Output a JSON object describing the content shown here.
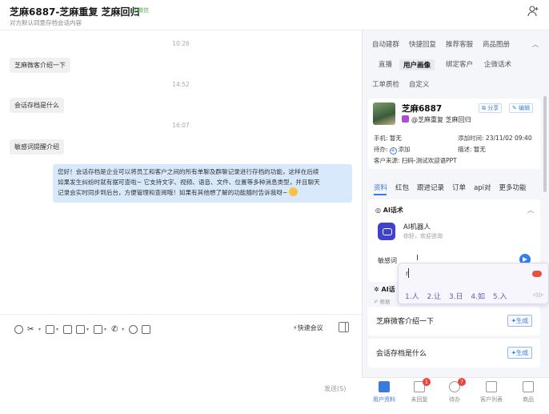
{
  "header": {
    "title": "芝麻6887-芝麻重复 芝麻回归",
    "tag": "@微信",
    "subtitle": "对方默认同意存档会话内容"
  },
  "chat": {
    "messages": [
      {
        "type": "time",
        "text": "10:26"
      },
      {
        "type": "left",
        "text": "芝麻微客介绍一下"
      },
      {
        "type": "time",
        "text": "14:52"
      },
      {
        "type": "left",
        "text": "会话存档是什么"
      },
      {
        "type": "time",
        "text": "16:07"
      },
      {
        "type": "left",
        "text": "敏感词提醒介绍"
      },
      {
        "type": "right",
        "line1": "您好！会话存档是企业可以将员工和客户之间的所有单聊及群聊记录进行存档的功能，这样在后续",
        "line2": "如果发生纠纷时就有据可查啦~ 它支持文字、视频、语音、文件、位置等多种消息类型，并且聊天",
        "line3": "记录会实时同步到后台，方便管理和查阅哦！如果有其他想了解的功能随时告诉我呀~"
      }
    ]
  },
  "composer": {
    "quick_meeting": "快速会议",
    "send_label": "发送(S)"
  },
  "right_panel": {
    "tabs_row1": [
      "自动建群",
      "快捷回复",
      "推荐客服",
      "商品图册"
    ],
    "tabs_row2": [
      "直播",
      "用户画像",
      "绑定客户",
      "企微话术"
    ],
    "tabs_row3": [
      "工单质检",
      "自定义"
    ],
    "active_tab": "用户画像",
    "customer": {
      "name": "芝麻6887",
      "wechat": "@芝麻重复 芝麻回归",
      "share_label": "分享",
      "edit_label": "编辑",
      "phone_label": "手机:",
      "phone_value": "暂无",
      "added_label": "添加时间:",
      "added_value": "23/11/02 09:40",
      "todo_label": "待办:",
      "todo_action": "添加",
      "desc_label": "描述:",
      "desc_value": "暂无",
      "source_label": "客户来源:",
      "source_value": "扫码-测试欢迎语PPT"
    },
    "detail_tabs": [
      "资料",
      "红包",
      "跟进记录",
      "订单",
      "api对",
      "更多功能"
    ],
    "active_detail_tab": "资料",
    "ai_script": {
      "header": "AI话术",
      "bot_name": "AI机器人",
      "bot_greeting": "你好，欢迎咨询",
      "input_text": "敏感词"
    },
    "ai_section2": {
      "header": "AI话",
      "sub": "根据"
    },
    "suggestions": [
      {
        "text": "芝麻微客介绍一下",
        "button": "生成"
      },
      {
        "text": "会话存档是什么",
        "button": "生成"
      }
    ]
  },
  "bottom_nav": [
    {
      "label": "用户资料",
      "active": true,
      "badge": ""
    },
    {
      "label": "未回复",
      "active": false,
      "badge": "1"
    },
    {
      "label": "待办",
      "active": false,
      "badge": "7"
    },
    {
      "label": "客户列表",
      "active": false,
      "badge": ""
    },
    {
      "label": "商品",
      "active": false,
      "badge": ""
    }
  ],
  "ime": {
    "composition": "r",
    "candidates": [
      "1.人",
      "2.让",
      "3.日",
      "4.如",
      "5.入"
    ],
    "arrows": "◁ ▷"
  },
  "colors": {
    "accent": "#3b7be0",
    "bubble_right": "#d7e9fb",
    "badge": "#e8453c"
  }
}
